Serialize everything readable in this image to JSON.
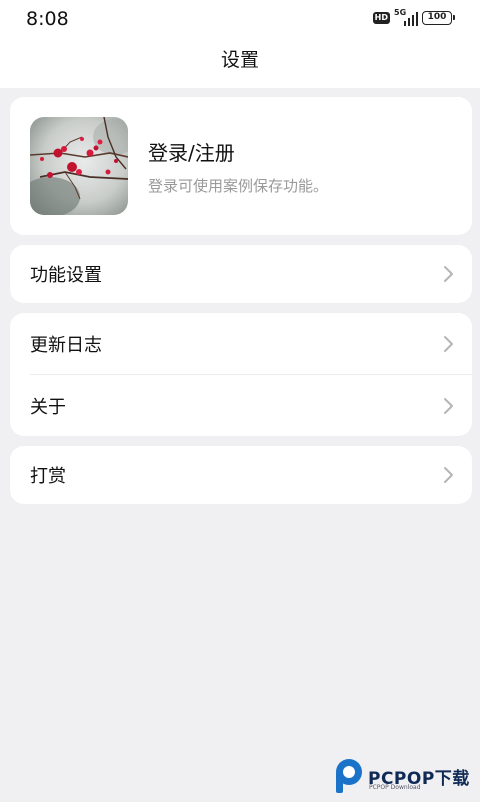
{
  "status_bar": {
    "time": "8:08",
    "hd": "HD",
    "network": "5G",
    "battery": "100"
  },
  "header": {
    "title": "设置"
  },
  "profile": {
    "title": "登录/注册",
    "subtitle": "登录可使用案例保存功能。",
    "avatar_icon": "plum-blossom-photo"
  },
  "menu": {
    "settings": "功能设置",
    "changelog": "更新日志",
    "about": "关于",
    "tip": "打赏",
    "chevron_icon": "chevron-right-icon"
  },
  "watermark": {
    "brand": "PCPOP下载",
    "sub": "PCPOP Download"
  },
  "colors": {
    "background": "#f0f0f3",
    "card": "#ffffff",
    "subtitle": "#9a9a9a",
    "chevron": "#b5b5b5"
  }
}
